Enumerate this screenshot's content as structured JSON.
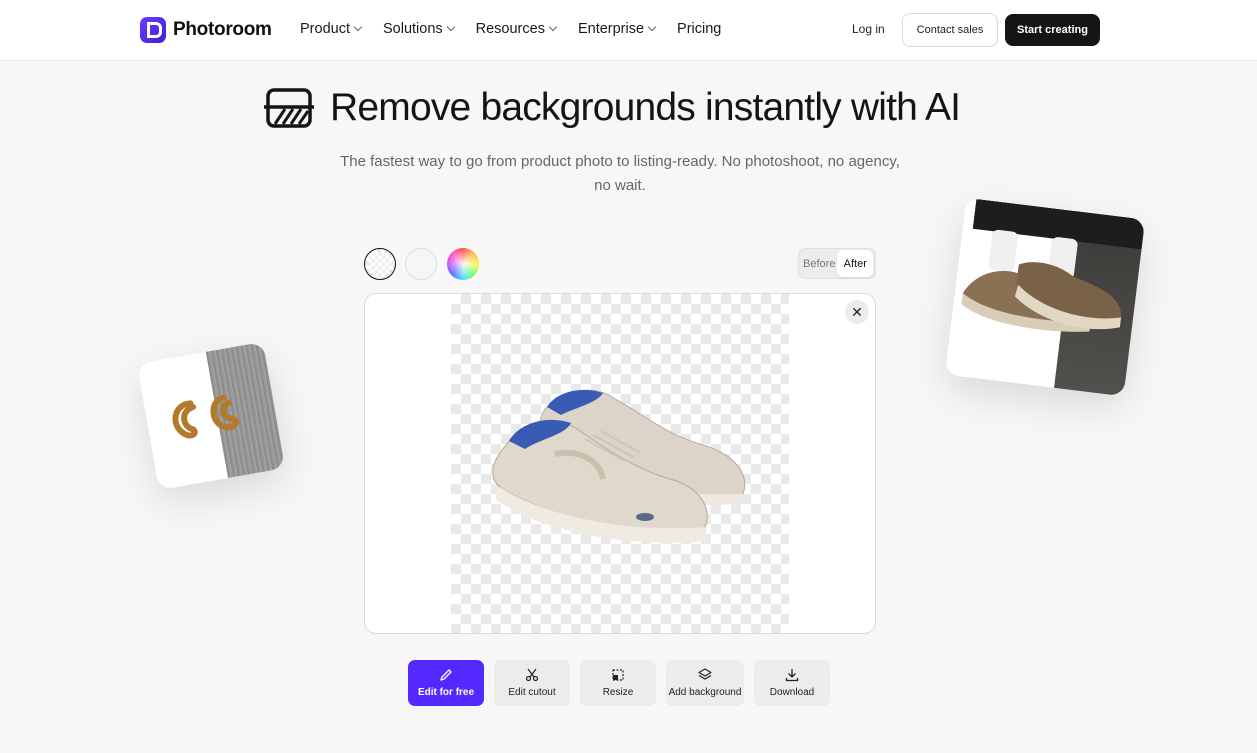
{
  "nav": {
    "brand": "Photoroom",
    "menu": [
      "Product",
      "Solutions",
      "Resources",
      "Enterprise"
    ],
    "pricing": "Pricing",
    "login": "Log in",
    "contact": "Contact sales",
    "start": "Start creating"
  },
  "hero": {
    "title": "Remove backgrounds instantly with AI",
    "subtitle": "The fastest way to go from product photo to listing-ready. No photoshoot, no agency, no wait."
  },
  "controls": {
    "before": "Before",
    "after": "After",
    "close": "✕"
  },
  "actions": {
    "edit_free": "Edit for free",
    "edit_cutout": "Edit cutout",
    "resize": "Resize",
    "add_background": "Add background",
    "download": "Download"
  },
  "colors": {
    "brand": "#5429ff",
    "dark_button": "#151515"
  }
}
